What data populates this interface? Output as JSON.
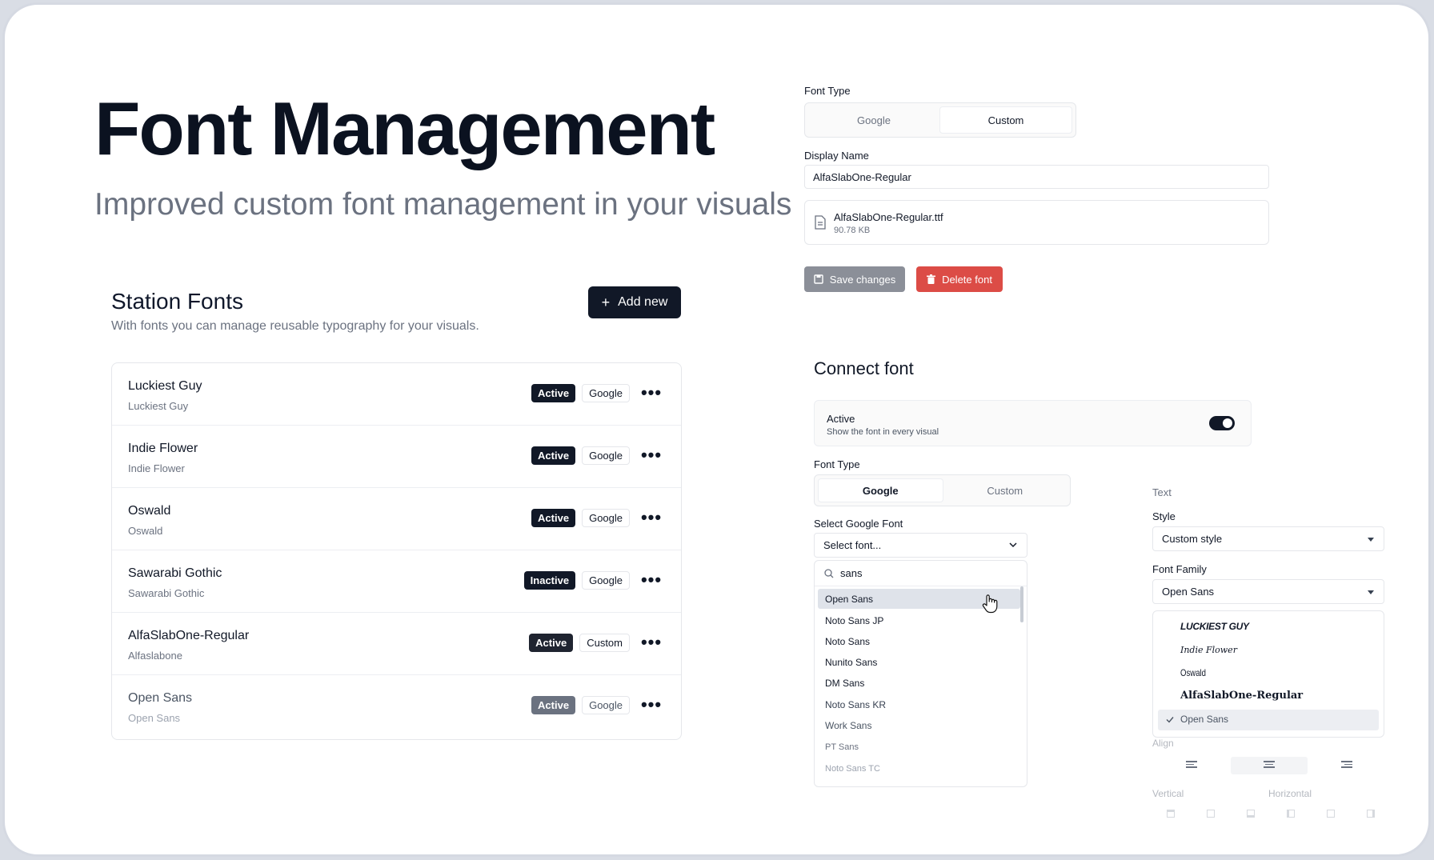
{
  "hero": {
    "title": "Font Management",
    "subtitle": "Improved custom font management in your visuals"
  },
  "station_fonts": {
    "title": "Station Fonts",
    "description": "With fonts you can manage reusable typography for your visuals.",
    "add_label": "Add new",
    "rows": [
      {
        "name": "Luckiest Guy",
        "sub": "Luckiest Guy",
        "status": "Active",
        "type": "Google"
      },
      {
        "name": "Indie Flower",
        "sub": "Indie Flower",
        "status": "Active",
        "type": "Google"
      },
      {
        "name": "Oswald",
        "sub": "Oswald",
        "status": "Active",
        "type": "Google"
      },
      {
        "name": "Sawarabi Gothic",
        "sub": "Sawarabi Gothic",
        "status": "Inactive",
        "type": "Google"
      },
      {
        "name": "AlfaSlabOne-Regular",
        "sub": "Alfaslabone",
        "status": "Active",
        "type": "Custom"
      },
      {
        "name": "Open Sans",
        "sub": "Open Sans",
        "status": "Active",
        "type": "Google"
      }
    ]
  },
  "edit_form": {
    "font_type_label": "Font Type",
    "font_type_options": [
      "Google",
      "Custom"
    ],
    "font_type_selected": "Custom",
    "display_name_label": "Display Name",
    "display_name_value": "AlfaSlabOne-Regular",
    "file_name": "AlfaSlabOne-Regular.ttf",
    "file_size": "90.78 KB",
    "save_label": "Save changes",
    "delete_label": "Delete font"
  },
  "connect_font": {
    "title": "Connect font",
    "active_label": "Active",
    "active_desc": "Show the font in every visual",
    "active_on": true,
    "font_type_label": "Font Type",
    "font_type_options": [
      "Google",
      "Custom"
    ],
    "font_type_selected": "Google",
    "select_label": "Select Google Font",
    "select_placeholder": "Select font...",
    "search_value": "sans",
    "options": [
      "Open Sans",
      "Noto Sans JP",
      "Noto Sans",
      "Nunito Sans",
      "DM Sans",
      "Noto Sans KR",
      "Work Sans",
      "PT Sans",
      "Noto Sans TC"
    ],
    "highlighted": "Open Sans"
  },
  "text_panel": {
    "section_label": "Text",
    "style_label": "Style",
    "style_value": "Custom style",
    "family_label": "Font Family",
    "family_value": "Open Sans",
    "family_options": [
      "LUCKIEST GUY",
      "Indie Flower",
      "Oswald",
      "AlfaSlabOne-Regular",
      "Open Sans"
    ],
    "family_selected": "Open Sans",
    "align_label": "Align",
    "vertical_label": "Vertical",
    "horizontal_label": "Horizontal"
  },
  "colors": {
    "primary": "#111827",
    "danger": "#dc4c46",
    "muted": "#6b7280"
  }
}
